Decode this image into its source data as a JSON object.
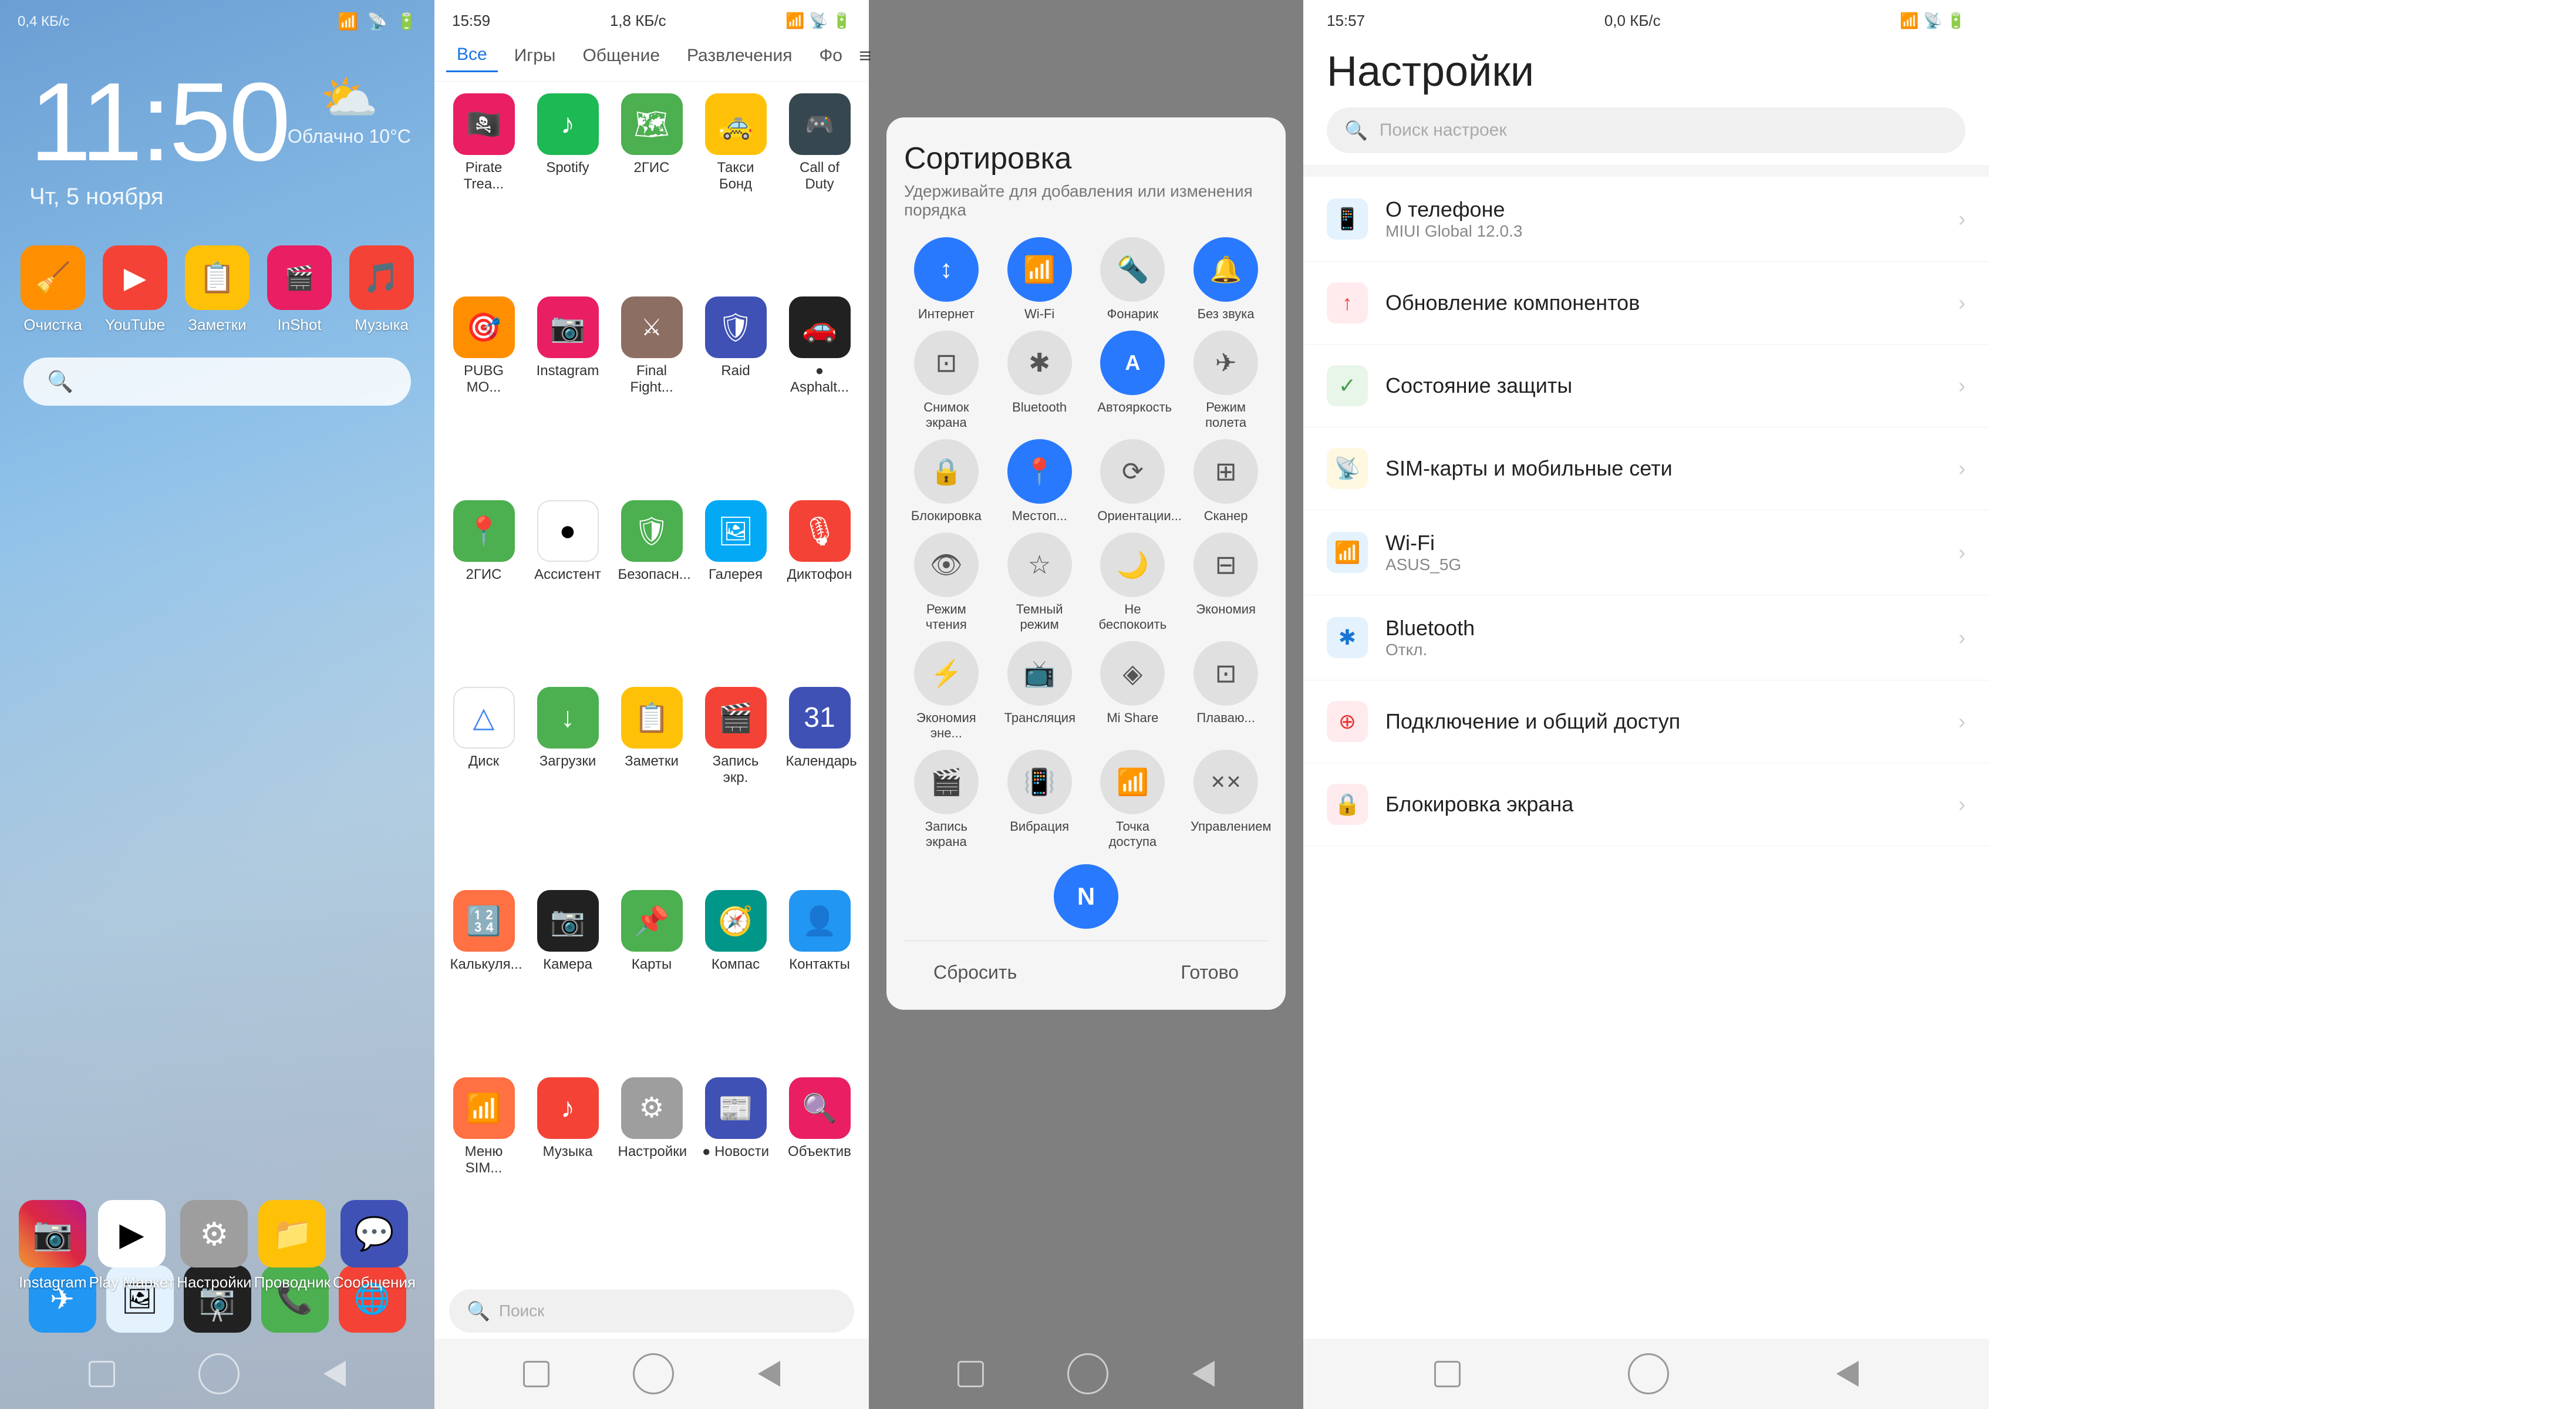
{
  "screen1": {
    "status_bar": {
      "left": "0,4 КБ/с",
      "right_signal": "▲▼",
      "right_battery": "95"
    },
    "time": "11:50",
    "date": "Чт, 5 ноября",
    "weather": {
      "icon": "⛅",
      "text": "Облачно 10°C"
    },
    "apps": [
      {
        "label": "Очистка",
        "icon": "🧹",
        "bg": "#ff8f00"
      },
      {
        "label": "YouTube",
        "icon": "▶",
        "bg": "#f44336"
      },
      {
        "label": "Заметки",
        "icon": "📋",
        "bg": "#ffc107"
      },
      {
        "label": "InShot",
        "icon": "🎬",
        "bg": "#e91e63"
      },
      {
        "label": "Музыка",
        "icon": "🎵",
        "bg": "#e53935"
      }
    ],
    "search_placeholder": "",
    "dock": [
      {
        "label": "Instagram",
        "icon": "📷",
        "bg": "linear-gradient(45deg,#f09433,#e6683c,#dc2743,#cc2366,#bc1888)"
      },
      {
        "label": "Play Маркет",
        "icon": "▶",
        "bg": "white"
      },
      {
        "label": "Настройки",
        "icon": "⚙",
        "bg": "#607d8b"
      },
      {
        "label": "Проводник",
        "icon": "📁",
        "bg": "#ffc107"
      },
      {
        "label": "Сообщения",
        "icon": "💬",
        "bg": "#1565c0"
      }
    ],
    "bottom_apps": [
      {
        "icon": "✈",
        "bg": "#1976d2"
      },
      {
        "icon": "🖼",
        "bg": "#f5f5f5"
      },
      {
        "icon": "📷",
        "bg": "#212121"
      },
      {
        "icon": "📞",
        "bg": "#4caf50"
      },
      {
        "icon": "🌐",
        "bg": "#f44336"
      }
    ]
  },
  "screen2": {
    "status_bar": {
      "time": "15:59",
      "data": "1,8 КБ/с",
      "battery": "67"
    },
    "tabs": [
      "Все",
      "Игры",
      "Общение",
      "Развлечения",
      "Фо"
    ],
    "apps": [
      {
        "label": "Pirate Trea...",
        "icon": "🏴‍☠️",
        "bg": "#e91e63"
      },
      {
        "label": "Spotify",
        "icon": "♪",
        "bg": "#1DB954"
      },
      {
        "label": "2ГИС",
        "icon": "🗺",
        "bg": "#4caf50"
      },
      {
        "label": "Такси Бонд",
        "icon": "🚕",
        "bg": "#ffc107"
      },
      {
        "label": "Call of Duty",
        "icon": "🎮",
        "bg": "#37474f"
      },
      {
        "label": "PUBG MO...",
        "icon": "🎯",
        "bg": "#ff8f00"
      },
      {
        "label": "Instagram",
        "icon": "📷",
        "bg": "#e91e63"
      },
      {
        "label": "Final Fight...",
        "icon": "⚔",
        "bg": "#8d6e63"
      },
      {
        "label": "Raid",
        "icon": "🛡",
        "bg": "#1565c0"
      },
      {
        "label": "● Asphalt...",
        "icon": "🚗",
        "bg": "#212121"
      },
      {
        "label": "2ГИС",
        "icon": "📍",
        "bg": "#4caf50"
      },
      {
        "label": "Ассистент",
        "icon": "●",
        "bg": "white"
      },
      {
        "label": "Безопасн...",
        "icon": "🛡",
        "bg": "#43a047"
      },
      {
        "label": "Галерея",
        "icon": "🖼",
        "bg": "#29b6f6"
      },
      {
        "label": "Диктофон",
        "icon": "🎙",
        "bg": "#e53935"
      },
      {
        "label": "Диск",
        "icon": "△",
        "bg": "white"
      },
      {
        "label": "Загрузки",
        "icon": "↓",
        "bg": "#4caf50"
      },
      {
        "label": "Заметки",
        "icon": "📋",
        "bg": "#ffc107"
      },
      {
        "label": "Запись экр.",
        "icon": "🎬",
        "bg": "#e53935"
      },
      {
        "label": "Календарь",
        "icon": "31",
        "bg": "#1565c0"
      },
      {
        "label": "Калькуля...",
        "icon": "🔢",
        "bg": "#ff7043"
      },
      {
        "label": "Камера",
        "icon": "📷",
        "bg": "#212121"
      },
      {
        "label": "Карты",
        "icon": "📌",
        "bg": "#4caf50"
      },
      {
        "label": "Компас",
        "icon": "🧭",
        "bg": "#009688"
      },
      {
        "label": "Контакты",
        "icon": "👤",
        "bg": "#1976d2"
      },
      {
        "label": "Меню SIM...",
        "icon": "📶",
        "bg": "#ff7043"
      },
      {
        "label": "Музыка",
        "icon": "♪",
        "bg": "#e53935"
      },
      {
        "label": "Настройки",
        "icon": "⚙",
        "bg": "#607d8b"
      },
      {
        "label": "● Новости",
        "icon": "📰",
        "bg": "#1565c0"
      },
      {
        "label": "Объектив",
        "icon": "🔍",
        "bg": "#e91e63"
      }
    ],
    "search_placeholder": "Поиск"
  },
  "screen3": {
    "title": "Сортировка",
    "subtitle": "Удерживайте для добавления или изменения порядка",
    "tiles": [
      {
        "label": "Интернет",
        "icon": "↕",
        "active": true
      },
      {
        "label": "Wi-Fi",
        "icon": "📶",
        "active": true
      },
      {
        "label": "Фонарик",
        "icon": "🔦",
        "active": false
      },
      {
        "label": "Без звука",
        "icon": "🔔",
        "active": true
      },
      {
        "label": "Снимок экрана",
        "icon": "⊡",
        "active": false
      },
      {
        "label": "Bluetooth",
        "icon": "✱",
        "active": false
      },
      {
        "label": "Автояркость",
        "icon": "A",
        "active": true
      },
      {
        "label": "Режим полета",
        "icon": "✈",
        "active": false
      },
      {
        "label": "Блокировка",
        "icon": "🔒",
        "active": false
      },
      {
        "label": "Местоп...",
        "icon": "📍",
        "active": true
      },
      {
        "label": "Ориентации...",
        "icon": "⟳",
        "active": false
      },
      {
        "label": "Сканер",
        "icon": "⊞",
        "active": false
      },
      {
        "label": "Режим чтения",
        "icon": "👁",
        "active": false
      },
      {
        "label": "Темный режим",
        "icon": "☆",
        "active": false
      },
      {
        "label": "Не беспокоить",
        "icon": "🌙",
        "active": false
      },
      {
        "label": "Экономия",
        "icon": "⊟",
        "active": false
      },
      {
        "label": "Экономия эне...",
        "icon": "⚡",
        "active": false
      },
      {
        "label": "Трансляция",
        "icon": "📺",
        "active": false
      },
      {
        "label": "Mi Share",
        "icon": "◈",
        "active": false
      },
      {
        "label": "Плаваю...",
        "icon": "⊡",
        "active": false
      },
      {
        "label": "Запись экрана",
        "icon": "🎬",
        "active": false
      },
      {
        "label": "Вибрация",
        "icon": "📳",
        "active": false
      },
      {
        "label": "Точка доступа",
        "icon": "📶",
        "active": false
      },
      {
        "label": "Управлением",
        "icon": "✕✕",
        "active": false
      },
      {
        "label": "N",
        "icon": "N",
        "active": true,
        "solo": true
      }
    ],
    "reset_label": "Сбросить",
    "done_label": "Готово"
  },
  "screen4": {
    "status_bar": {
      "time": "15:57",
      "data": "0,0 КБ/с",
      "battery": "62"
    },
    "title": "Настройки",
    "search_placeholder": "Поиск настроек",
    "items": [
      {
        "icon": "📱",
        "bg": "#29b6f6",
        "title": "О телефоне",
        "value": "MIUI Global 12.0.3",
        "color": "#29b6f6"
      },
      {
        "icon": "↑",
        "bg": "#f44336",
        "title": "Обновление компонентов",
        "value": "",
        "color": "#f44336"
      },
      {
        "icon": "✓",
        "bg": "#43a047",
        "title": "Состояние защиты",
        "value": "",
        "color": "#43a047"
      },
      {
        "icon": "📡",
        "bg": "#ffc107",
        "title": "SIM-карты и мобильные сети",
        "value": "",
        "color": "#ffc107"
      },
      {
        "icon": "📶",
        "bg": "#29b6f6",
        "title": "Wi-Fi",
        "value": "ASUS_5G",
        "color": "#29b6f6"
      },
      {
        "icon": "✱",
        "bg": "#1976d2",
        "title": "Bluetooth",
        "value": "Откл.",
        "color": "#1976d2"
      },
      {
        "icon": "⊕",
        "bg": "#e53935",
        "title": "Подключение и общий доступ",
        "value": "",
        "color": "#e53935"
      },
      {
        "icon": "🔒",
        "bg": "#e53935",
        "title": "Блокировка экрана",
        "value": "",
        "color": "#e53935"
      }
    ]
  }
}
